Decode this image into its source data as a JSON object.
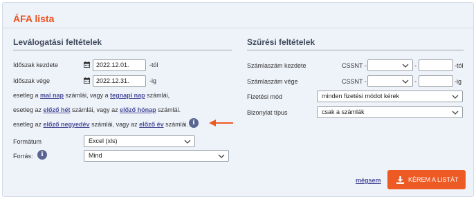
{
  "title": "ÁFA lista",
  "left": {
    "heading": "Leválogatási feltételek",
    "period_start_label": "Időszak kezdete",
    "period_start_value": "2022.12.01.",
    "period_start_suffix": "-tól",
    "period_end_label": "Időszak vége",
    "period_end_value": "2022.12.31.",
    "period_end_suffix": "-ig",
    "line1": {
      "t1": "esetleg a ",
      "l1": "mai nap",
      "t2": " számlái, vagy a ",
      "l2": "tegnapi nap",
      "t3": " számlái,"
    },
    "line2": {
      "t1": "esetleg az ",
      "l1": "előző hét",
      "t2": " számlái, vagy az ",
      "l2": "előző hónap",
      "t3": " számlái."
    },
    "line3": {
      "t1": "esetleg az ",
      "l1": "előző negyedév",
      "t2": " számlái, vagy az ",
      "l2": "előző év",
      "t3": " számlái."
    },
    "format_label": "Formátum",
    "format_value": "Excel (xls)",
    "source_label": "Forrás:",
    "source_value": "Mind",
    "info_glyph": "i"
  },
  "right": {
    "heading": "Szűrési feltételek",
    "invoice_start_label": "Számlaszám kezdete",
    "invoice_end_label": "Számlaszám vége",
    "prefix": "CSSNT -",
    "dash": "-",
    "suffix_from": "-tól",
    "suffix_to": "-ig",
    "payment_label": "Fizetési mód",
    "payment_value": "minden fizetési módot kérek",
    "doc_type_label": "Bizonylat típus",
    "doc_type_value": "csak a számlák"
  },
  "actions": {
    "cancel_label": "mégsem",
    "submit_label": "KÉREM A LISTÁT"
  },
  "colors": {
    "accent": "#ee5a24",
    "title": "#e8501c",
    "link": "#4a4e9a",
    "info": "#5a6691",
    "panel": "#eef2f9"
  },
  "icons": {
    "calendar": "calendar-icon",
    "info": "info-icon",
    "chevron": "chevron-down-icon",
    "download": "download-icon",
    "arrow": "arrow-left-icon"
  }
}
